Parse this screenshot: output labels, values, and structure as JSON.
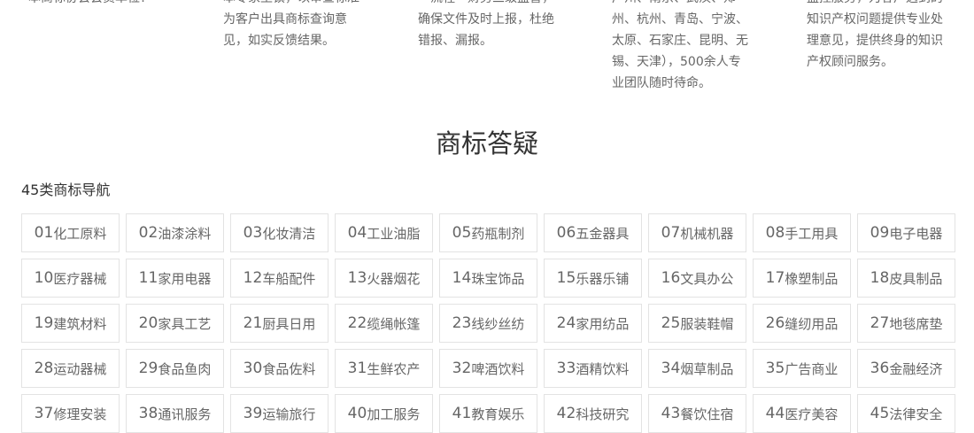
{
  "features": [
    {
      "lines": [
        "本商标协会会员单位！"
      ]
    },
    {
      "lines": [
        "本专家坐镇，以审查标准",
        "为客户出具商标查询意",
        "见，如实反馈结果。"
      ]
    },
    {
      "lines": [
        "一流程一财务三级监督，",
        "确保文件及时上报，杜绝",
        "错报、漏报。"
      ]
    },
    {
      "lines": [
        "广州、南京、武汉、郑",
        "州、杭州、青岛、宁波、",
        "太原、石家庄、昆明、无",
        "锡、天津），500余人专",
        "业团队随时待命。"
      ]
    },
    {
      "lines": [
        "监控服务，为客户遇到的",
        "知识产权问题提供专业处",
        "理意见，提供终身的知识",
        "产权顾问服务。"
      ]
    }
  ],
  "section_title": "商标答疑",
  "nav_title": "45类商标导航",
  "categories": [
    {
      "num": "01",
      "name": "化工原料"
    },
    {
      "num": "02",
      "name": "油漆涂料"
    },
    {
      "num": "03",
      "name": "化妆清洁"
    },
    {
      "num": "04",
      "name": "工业油脂"
    },
    {
      "num": "05",
      "name": "药瓶制剂"
    },
    {
      "num": "06",
      "name": "五金器具"
    },
    {
      "num": "07",
      "name": "机械机器"
    },
    {
      "num": "08",
      "name": "手工用具"
    },
    {
      "num": "09",
      "name": "电子电器"
    },
    {
      "num": "10",
      "name": "医疗器械"
    },
    {
      "num": "11",
      "name": "家用电器"
    },
    {
      "num": "12",
      "name": "车船配件"
    },
    {
      "num": "13",
      "name": "火器烟花"
    },
    {
      "num": "14",
      "name": "珠宝饰品"
    },
    {
      "num": "15",
      "name": "乐器乐铺"
    },
    {
      "num": "16",
      "name": "文具办公"
    },
    {
      "num": "17",
      "name": "橡塑制品"
    },
    {
      "num": "18",
      "name": "皮具制品"
    },
    {
      "num": "19",
      "name": "建筑材料"
    },
    {
      "num": "20",
      "name": "家具工艺"
    },
    {
      "num": "21",
      "name": "厨具日用"
    },
    {
      "num": "22",
      "name": "缆绳帐篷"
    },
    {
      "num": "23",
      "name": "线纱丝纺"
    },
    {
      "num": "24",
      "name": "家用纺品"
    },
    {
      "num": "25",
      "name": "服装鞋帽"
    },
    {
      "num": "26",
      "name": "缝纫用品"
    },
    {
      "num": "27",
      "name": "地毯席垫"
    },
    {
      "num": "28",
      "name": "运动器械"
    },
    {
      "num": "29",
      "name": "食品鱼肉"
    },
    {
      "num": "30",
      "name": "食品佐料"
    },
    {
      "num": "31",
      "name": "生鲜农产"
    },
    {
      "num": "32",
      "name": "啤酒饮料"
    },
    {
      "num": "33",
      "name": "酒精饮料"
    },
    {
      "num": "34",
      "name": "烟草制品"
    },
    {
      "num": "35",
      "name": "广告商业"
    },
    {
      "num": "36",
      "name": "金融经济"
    },
    {
      "num": "37",
      "name": "修理安装"
    },
    {
      "num": "38",
      "name": "通讯服务"
    },
    {
      "num": "39",
      "name": "运输旅行"
    },
    {
      "num": "40",
      "name": "加工服务"
    },
    {
      "num": "41",
      "name": "教育娱乐"
    },
    {
      "num": "42",
      "name": "科技研究"
    },
    {
      "num": "43",
      "name": "餐饮住宿"
    },
    {
      "num": "44",
      "name": "医疗美容"
    },
    {
      "num": "45",
      "name": "法律安全"
    }
  ]
}
